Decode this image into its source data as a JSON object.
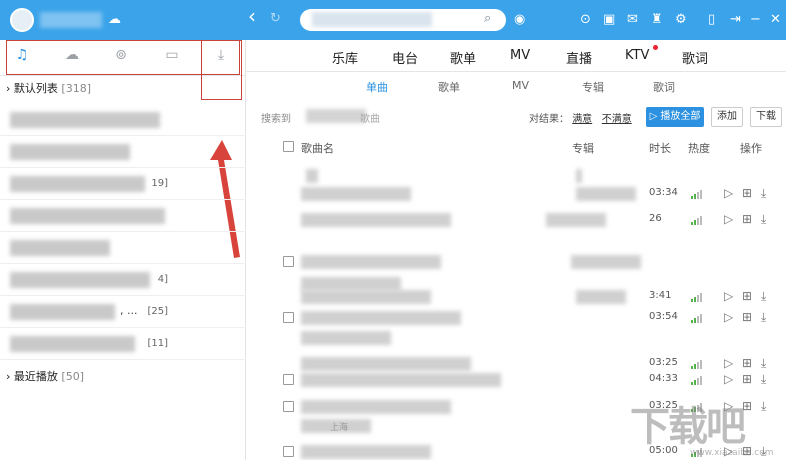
{
  "topbar": {
    "nav_back": "‹",
    "nav_refresh": "↻",
    "icons": [
      "skin-icon",
      "message-icon",
      "mail-icon",
      "shirt-icon",
      "settings-icon",
      "mobile-icon",
      "minimize-icon",
      "restore-icon",
      "close-icon"
    ]
  },
  "sidebar": {
    "tabs": [
      "music-note-icon",
      "cloud-icon",
      "radio-icon",
      "device-icon",
      "download-icon"
    ],
    "default_list": {
      "label": "默认列表",
      "count": "[318]"
    },
    "rows": [
      {
        "count": ""
      },
      {
        "count": ""
      },
      {
        "count": "19]"
      },
      {
        "count": ""
      },
      {
        "count": ""
      },
      {
        "count": "4]"
      },
      {
        "count": "[25]"
      },
      {
        "count": "[11]"
      }
    ],
    "recent": {
      "label": "最近播放",
      "count": "[50]"
    },
    "row_suffix_6": ", ..."
  },
  "nav": {
    "tabs": [
      "乐库",
      "电台",
      "歌单",
      "MV",
      "直播",
      "KTV",
      "歌词"
    ],
    "sub_tabs": [
      "单曲",
      "歌单",
      "MV",
      "专辑",
      "歌词"
    ]
  },
  "results": {
    "search_prefix": "搜索到",
    "search_tail": "歌曲",
    "feedback_label": "对结果：",
    "satisfied": "满意",
    "unsatisfied": "不满意",
    "play_all": "▷ 播放全部",
    "add": "添加",
    "download": "下载"
  },
  "table": {
    "headers": {
      "title": "歌曲名",
      "album": "专辑",
      "duration": "时长",
      "heat": "热度",
      "ops": "操作"
    },
    "rows": [
      {
        "time": "",
        "has_check": false
      },
      {
        "time": "03:34",
        "has_check": false
      },
      {
        "time": "26",
        "has_check": false
      },
      {
        "time": "",
        "has_check": true
      },
      {
        "time": "",
        "has_check": false
      },
      {
        "time": "3:41",
        "has_check": false
      },
      {
        "time": "03:54",
        "has_check": true
      },
      {
        "time": "",
        "has_check": false
      },
      {
        "time": "03:25",
        "has_check": false
      },
      {
        "time": "04:33",
        "has_check": true
      },
      {
        "time": "03:25",
        "has_check": true
      },
      {
        "time": "",
        "has_check": false
      },
      {
        "time": "05:00",
        "has_check": true
      }
    ],
    "sub_note": "上海"
  },
  "watermark": {
    "big": "下载吧",
    "small": "www.xiazaiba.com"
  },
  "colors": {
    "topbar": "#3aa3ea",
    "accent": "#2b91e0",
    "annotation": "#c8443b"
  }
}
